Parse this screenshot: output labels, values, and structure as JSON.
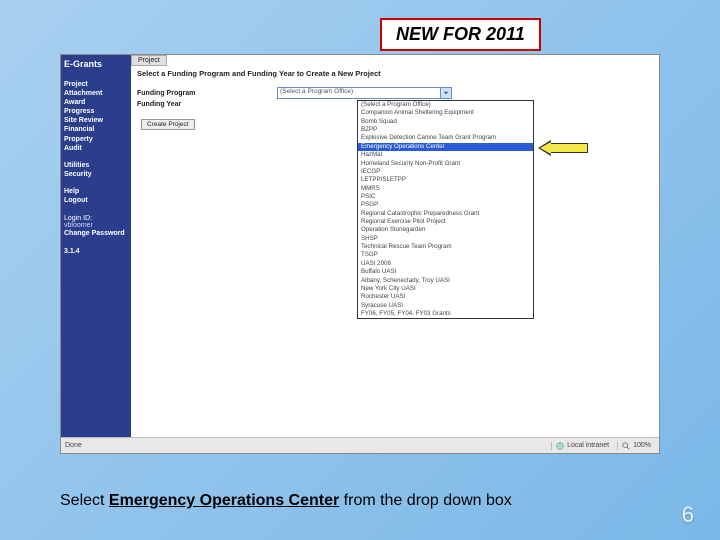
{
  "badge": "NEW FOR 2011",
  "sidebar": {
    "header": "E-Grants",
    "group1": [
      "Project",
      "Attachment",
      "Award",
      "Progress",
      "Site Review",
      "Financial",
      "Property",
      "Audit"
    ],
    "group2": [
      "Utilities",
      "Security"
    ],
    "group3": [
      "Help",
      "Logout"
    ],
    "login_label": "Login ID:",
    "login_id": "vbloomer",
    "change_pw": "Change Password",
    "version": "3.1.4"
  },
  "main": {
    "tab": "Project",
    "title": "Select a Funding Program and Funding Year to Create a New Project",
    "label_program": "Funding Program",
    "label_year": "Funding Year",
    "select_placeholder": "(Select a Program Office)",
    "create_btn": "Create Project",
    "options": [
      "(Select a Program Office)",
      "Companion Animal Sheltering Equipment",
      "Bomb Squad",
      "BZPP",
      "Explosive Detection Canine Team Grant Program",
      "Emergency Operations Center",
      "HazMat",
      "Homeland Security Non-Profit Grant",
      "IECGP",
      "LETPP/SLETPP",
      "MMRS",
      "PSIC",
      "PSGP",
      "Regional Catastrophic Preparedness Grant",
      "Regional Exercise Pilot Project",
      "Operation Stonegarden",
      "SHSP",
      "Technical Rescue Team Program",
      "TSGP",
      "UASI 2006",
      "Buffalo UASI",
      "Albany, Schenectady, Troy UASI",
      "New York City UASI",
      "Rochester UASI",
      "Syracuse UASI",
      "FY06, FY05, FY04, FY03 Grants"
    ],
    "highlight_index": 5
  },
  "statusbar": {
    "left": "Done",
    "intranet": "Local intranet",
    "zoom": "100%"
  },
  "caption": {
    "pre": "Select ",
    "underline": "Emergency Operations Center",
    "post": " from the drop down box"
  },
  "page_number": "6"
}
